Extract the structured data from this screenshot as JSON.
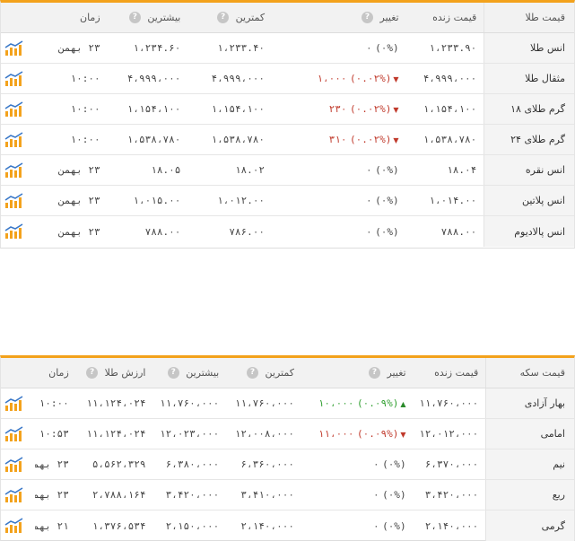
{
  "gold_table": {
    "headers": {
      "name": "قیمت طلا",
      "live": "قیمت زنده",
      "change": "تغییر",
      "min": "کمترین",
      "max": "بیشترین",
      "time": "زمان",
      "help_glyph": "?"
    },
    "rows": [
      {
        "name": "انس طلا",
        "live": "۱،۲۳۳.۹۰",
        "change_pct": "(۰%)",
        "change_val": "۰",
        "dir": "none",
        "min": "۱،۲۳۳.۴۰",
        "max": "۱،۲۳۴.۶۰",
        "time": "۲۳ بهمن"
      },
      {
        "name": "مثقال طلا",
        "live": "۴،۹۹۹،۰۰۰",
        "change_pct": "(۰.۰۲%)",
        "change_val": "۱،۰۰۰",
        "dir": "down",
        "min": "۴،۹۹۹،۰۰۰",
        "max": "۴،۹۹۹،۰۰۰",
        "time": "۱۰:۰۰"
      },
      {
        "name": "گرم طلای ۱۸",
        "live": "۱،۱۵۴،۱۰۰",
        "change_pct": "(۰.۰۲%)",
        "change_val": "۲۳۰",
        "dir": "down",
        "min": "۱،۱۵۴،۱۰۰",
        "max": "۱،۱۵۴،۱۰۰",
        "time": "۱۰:۰۰"
      },
      {
        "name": "گرم طلای ۲۴",
        "live": "۱،۵۳۸،۷۸۰",
        "change_pct": "(۰.۰۲%)",
        "change_val": "۳۱۰",
        "dir": "down",
        "min": "۱،۵۳۸،۷۸۰",
        "max": "۱،۵۳۸،۷۸۰",
        "time": "۱۰:۰۰"
      },
      {
        "name": "انس نقره",
        "live": "۱۸.۰۴",
        "change_pct": "(۰%)",
        "change_val": "۰",
        "dir": "none",
        "min": "۱۸.۰۲",
        "max": "۱۸.۰۵",
        "time": "۲۳ بهمن"
      },
      {
        "name": "انس پلاتین",
        "live": "۱،۰۱۴.۰۰",
        "change_pct": "(۰%)",
        "change_val": "۰",
        "dir": "none",
        "min": "۱،۰۱۲.۰۰",
        "max": "۱،۰۱۵.۰۰",
        "time": "۲۳ بهمن"
      },
      {
        "name": "انس پالادیوم",
        "live": "۷۸۸.۰۰",
        "change_pct": "(۰%)",
        "change_val": "۰",
        "dir": "none",
        "min": "۷۸۶.۰۰",
        "max": "۷۸۸.۰۰",
        "time": "۲۳ بهمن"
      }
    ]
  },
  "coin_table": {
    "headers": {
      "name": "قیمت سکه",
      "live": "قیمت زنده",
      "change": "تغییر",
      "min": "کمترین",
      "max": "بیشترین",
      "gold_value": "ارزش طلا",
      "time": "زمان",
      "help_glyph": "?"
    },
    "rows": [
      {
        "name": "بهار آزادی",
        "live": "۱۱،۷۶۰،۰۰۰",
        "change_pct": "(۰.۰۹%)",
        "change_val": "۱۰،۰۰۰",
        "dir": "up",
        "min": "۱۱،۷۶۰،۰۰۰",
        "max": "۱۱،۷۶۰،۰۰۰",
        "gold_value": "۱۱،۱۲۴،۰۲۴",
        "time": "۱۰:۰۰"
      },
      {
        "name": "امامی",
        "live": "۱۲،۰۱۲،۰۰۰",
        "change_pct": "(۰.۰۹%)",
        "change_val": "۱۱،۰۰۰",
        "dir": "down",
        "min": "۱۲،۰۰۸،۰۰۰",
        "max": "۱۲،۰۲۳،۰۰۰",
        "gold_value": "۱۱،۱۲۴،۰۲۴",
        "time": "۱۰:۵۳"
      },
      {
        "name": "نیم",
        "live": "۶،۳۷۰،۰۰۰",
        "change_pct": "(۰%)",
        "change_val": "۰",
        "dir": "none",
        "min": "۶،۳۶۰،۰۰۰",
        "max": "۶،۳۸۰،۰۰۰",
        "gold_value": "۵،۵۶۲،۳۲۹",
        "time": "۲۳ بهمن"
      },
      {
        "name": "ربع",
        "live": "۳،۴۲۰،۰۰۰",
        "change_pct": "(۰%)",
        "change_val": "۰",
        "dir": "none",
        "min": "۳،۴۱۰،۰۰۰",
        "max": "۳،۴۲۰،۰۰۰",
        "gold_value": "۲،۷۸۸،۱۶۴",
        "time": "۲۳ بهمن"
      },
      {
        "name": "گرمی",
        "live": "۲،۱۴۰،۰۰۰",
        "change_pct": "(۰%)",
        "change_val": "۰",
        "dir": "none",
        "min": "۲،۱۴۰،۰۰۰",
        "max": "۲،۱۵۰،۰۰۰",
        "gold_value": "۱،۳۷۶،۵۳۴",
        "time": "۲۱ بهمن"
      }
    ]
  },
  "icons": {
    "chart": "bar-chart-icon",
    "help": "question-mark-icon",
    "arrow_up": "▲",
    "arrow_down": "▼"
  },
  "colors": {
    "accent": "#f3a21c",
    "negative": "#c0392b",
    "positive": "#2e9e2e",
    "chart_bar": "#f3a21c",
    "chart_line": "#3a78c8"
  }
}
